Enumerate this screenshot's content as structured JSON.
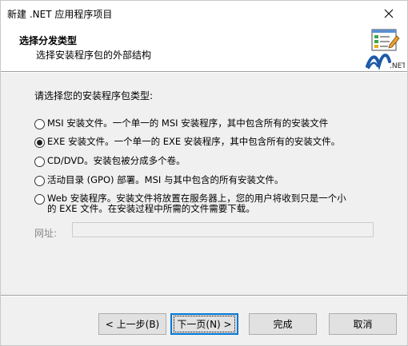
{
  "window": {
    "title": "新建 .NET 应用程序项目"
  },
  "header": {
    "title": "选择分发类型",
    "subtitle": "选择安装程序包的外部结构",
    "logo_text": ".NET"
  },
  "content": {
    "prompt": "请选择您的安装程序包类型:",
    "options": [
      {
        "label": "MSI 安装文件。一个单一的 MSI 安装程序，其中包含所有的安装文件",
        "checked": false
      },
      {
        "label": "EXE 安装文件。一个单一的 EXE 安装程序，其中包含所有的安装文件。",
        "checked": true
      },
      {
        "label": "CD/DVD。安装包被分成多个卷。",
        "checked": false
      },
      {
        "label": "活动目录 (GPO) 部署。MSI 与其中包含的所有安装文件。",
        "checked": false
      },
      {
        "label": "Web 安装程序。安装文件将放置在服务器上，您的用户将收到只是一个小的 EXE 文件。在安装过程中所需的文件需要下载。",
        "checked": false
      }
    ],
    "url_label": "网址:",
    "url_value": ""
  },
  "buttons": {
    "back": "< 上一步(B)",
    "next": "下一页(N) >",
    "finish": "完成",
    "cancel": "取消"
  },
  "colors": {
    "accent": "#0078d7",
    "dialog_bg": "#f0f0f0",
    "header_bg": "#ffffff",
    "disabled_text": "#8a8a8a"
  }
}
